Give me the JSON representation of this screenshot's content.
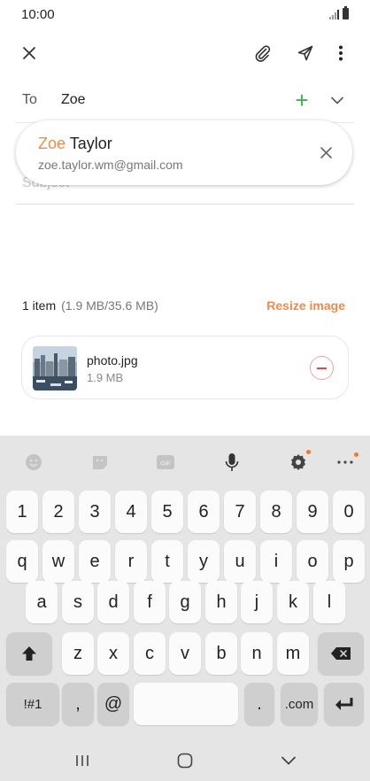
{
  "status": {
    "time": "10:00"
  },
  "toolbar": {
    "close_icon": "close-icon",
    "attach_icon": "paperclip-icon",
    "send_icon": "send-icon",
    "more_icon": "more-vertical-icon"
  },
  "recipient": {
    "to_label": "To",
    "to_value": "Zoe",
    "add_icon": "+"
  },
  "subject": {
    "placeholder": "Subject"
  },
  "suggestion": {
    "name_match": "Zoe",
    "name_rest": " Taylor",
    "email": "zoe.taylor.wm@gmail.com"
  },
  "attachments": {
    "count": "1 item",
    "size": "(1.9 MB/35.6 MB)",
    "resize_label": "Resize image",
    "file_name": "photo.jpg",
    "file_size": "1.9 MB"
  },
  "keyboard": {
    "number_row": [
      "1",
      "2",
      "3",
      "4",
      "5",
      "6",
      "7",
      "8",
      "9",
      "0"
    ],
    "row1": [
      "q",
      "w",
      "e",
      "r",
      "t",
      "y",
      "u",
      "i",
      "o",
      "p"
    ],
    "row2": [
      "a",
      "s",
      "d",
      "f",
      "g",
      "h",
      "j",
      "k",
      "l"
    ],
    "row3": [
      "z",
      "x",
      "c",
      "v",
      "b",
      "n",
      "m"
    ],
    "symbols_key": "!#1",
    "comma_key": ",",
    "at_key": "@",
    "period_key": ".",
    "dotcom_key": ".com"
  },
  "colors": {
    "accent": "#f08a4b",
    "add": "#3fb24b",
    "remove": "#e0474c",
    "keyboard_bg": "#e5e5e5"
  }
}
